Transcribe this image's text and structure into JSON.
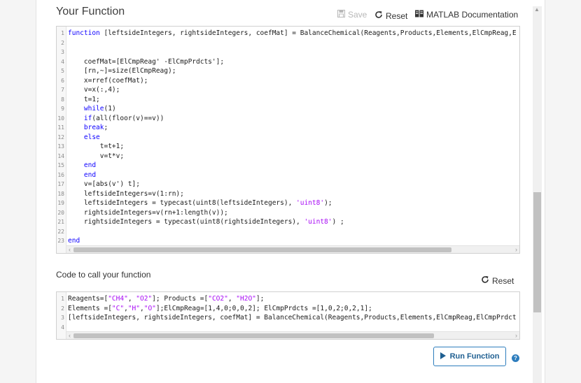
{
  "header": {
    "title": "Your Function",
    "save_label": "Save",
    "reset_label": "Reset",
    "doc_label": "MATLAB Documentation"
  },
  "editor1": {
    "lines": [
      {
        "n": "1",
        "segs": [
          {
            "t": "function",
            "k": "kw"
          },
          {
            "t": " [leftsideIntegers, rightsideIntegers, coefMat] = BalanceChemical(Reagents,Products,Elements,ElCmpReag,E",
            "k": ""
          }
        ]
      },
      {
        "n": "2",
        "segs": []
      },
      {
        "n": "3",
        "segs": []
      },
      {
        "n": "4",
        "segs": [
          {
            "t": "    coefMat=[ElCmpReag' -ElCmpPrdcts'];",
            "k": ""
          }
        ]
      },
      {
        "n": "5",
        "segs": [
          {
            "t": "    [rn,~]=size(ElCmpReag);",
            "k": ""
          }
        ]
      },
      {
        "n": "6",
        "segs": [
          {
            "t": "    x=rref(coefMat);",
            "k": ""
          }
        ]
      },
      {
        "n": "7",
        "segs": [
          {
            "t": "    v=x(:,4);",
            "k": ""
          }
        ]
      },
      {
        "n": "8",
        "segs": [
          {
            "t": "    t=1;",
            "k": ""
          }
        ]
      },
      {
        "n": "9",
        "segs": [
          {
            "t": "    ",
            "k": ""
          },
          {
            "t": "while",
            "k": "kw"
          },
          {
            "t": "(1)",
            "k": ""
          }
        ]
      },
      {
        "n": "10",
        "segs": [
          {
            "t": "    ",
            "k": ""
          },
          {
            "t": "if",
            "k": "kw"
          },
          {
            "t": "(all(floor(v)==v))",
            "k": ""
          }
        ]
      },
      {
        "n": "11",
        "segs": [
          {
            "t": "    ",
            "k": ""
          },
          {
            "t": "break",
            "k": "kw"
          },
          {
            "t": ";",
            "k": ""
          }
        ]
      },
      {
        "n": "12",
        "segs": [
          {
            "t": "    ",
            "k": ""
          },
          {
            "t": "else",
            "k": "kw"
          }
        ]
      },
      {
        "n": "13",
        "segs": [
          {
            "t": "        t=t+1;",
            "k": ""
          }
        ]
      },
      {
        "n": "14",
        "segs": [
          {
            "t": "        v=t*v;",
            "k": ""
          }
        ]
      },
      {
        "n": "15",
        "segs": [
          {
            "t": "    ",
            "k": ""
          },
          {
            "t": "end",
            "k": "kw"
          }
        ]
      },
      {
        "n": "16",
        "segs": [
          {
            "t": "    ",
            "k": ""
          },
          {
            "t": "end",
            "k": "kw"
          }
        ]
      },
      {
        "n": "17",
        "segs": [
          {
            "t": "    v=[abs(v') t];",
            "k": ""
          }
        ]
      },
      {
        "n": "18",
        "segs": [
          {
            "t": "    leftsideIntegers=v(1:rn);",
            "k": ""
          }
        ]
      },
      {
        "n": "19",
        "segs": [
          {
            "t": "    leftsideIntegers = typecast(uint8(leftsideIntegers), ",
            "k": ""
          },
          {
            "t": "'uint8'",
            "k": "str"
          },
          {
            "t": ");",
            "k": ""
          }
        ]
      },
      {
        "n": "20",
        "segs": [
          {
            "t": "    rightsideIntegers=v(rn+1:length(v));",
            "k": ""
          }
        ]
      },
      {
        "n": "21",
        "segs": [
          {
            "t": "    rightsideIntegers = typecast(uint8(rightsideIntegers), ",
            "k": ""
          },
          {
            "t": "'uint8'",
            "k": "str"
          },
          {
            "t": ") ;",
            "k": ""
          }
        ]
      },
      {
        "n": "22",
        "segs": []
      },
      {
        "n": "23",
        "segs": [
          {
            "t": "end",
            "k": "kw"
          }
        ]
      }
    ]
  },
  "caller": {
    "title": "Code to call your function",
    "reset_label": "Reset",
    "lines": [
      {
        "n": "1",
        "segs": [
          {
            "t": "Reagents=[",
            "k": ""
          },
          {
            "t": "\"CH4\"",
            "k": "str"
          },
          {
            "t": ", ",
            "k": ""
          },
          {
            "t": "\"O2\"",
            "k": "str"
          },
          {
            "t": "]; Products =[",
            "k": ""
          },
          {
            "t": "\"CO2\"",
            "k": "str"
          },
          {
            "t": ", ",
            "k": ""
          },
          {
            "t": "\"H2O\"",
            "k": "str"
          },
          {
            "t": "];",
            "k": ""
          }
        ]
      },
      {
        "n": "2",
        "segs": [
          {
            "t": "Elements =[",
            "k": ""
          },
          {
            "t": "\"C\"",
            "k": "str"
          },
          {
            "t": ",",
            "k": ""
          },
          {
            "t": "\"H\"",
            "k": "str"
          },
          {
            "t": ",",
            "k": ""
          },
          {
            "t": "\"O\"",
            "k": "str"
          },
          {
            "t": "];ElCmpReag=[1,4,0;0,0,2]; ElCmpPrdcts =[1,0,2;0,2,1];",
            "k": ""
          }
        ]
      },
      {
        "n": "3",
        "segs": [
          {
            "t": "[leftsideIntegers, rightsideIntegers, coefMat] = BalanceChemical(Reagents,Products,Elements,ElCmpReag,ElCmpPrdct",
            "k": ""
          }
        ]
      },
      {
        "n": "4",
        "segs": []
      }
    ]
  },
  "run": {
    "label": "Run Function",
    "help": "?"
  },
  "colors": {
    "keyword": "#0e00ff",
    "string": "#a709f5",
    "accent": "#2d7dbd"
  }
}
